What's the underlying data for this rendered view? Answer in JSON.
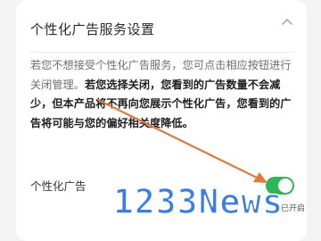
{
  "section": {
    "title": "个性化广告服务设置",
    "collapse_icon": "chevron-up-icon"
  },
  "description": {
    "normal": "若您不想接受个性化广告服务，您可点击相应按钮进行关闭管理。",
    "bold": "若您选择关闭，您看到的广告数量不会减少，但本产品将不再向您展示个性化广告，您看到的广告将可能与您的偏好相关度降低。"
  },
  "setting": {
    "label": "个性化广告",
    "state": "on",
    "status_text": "已开启",
    "accent_color": "#2db559"
  },
  "annotation": {
    "arrow_color": "#e07a3c"
  },
  "watermark": {
    "text": "1233News"
  }
}
